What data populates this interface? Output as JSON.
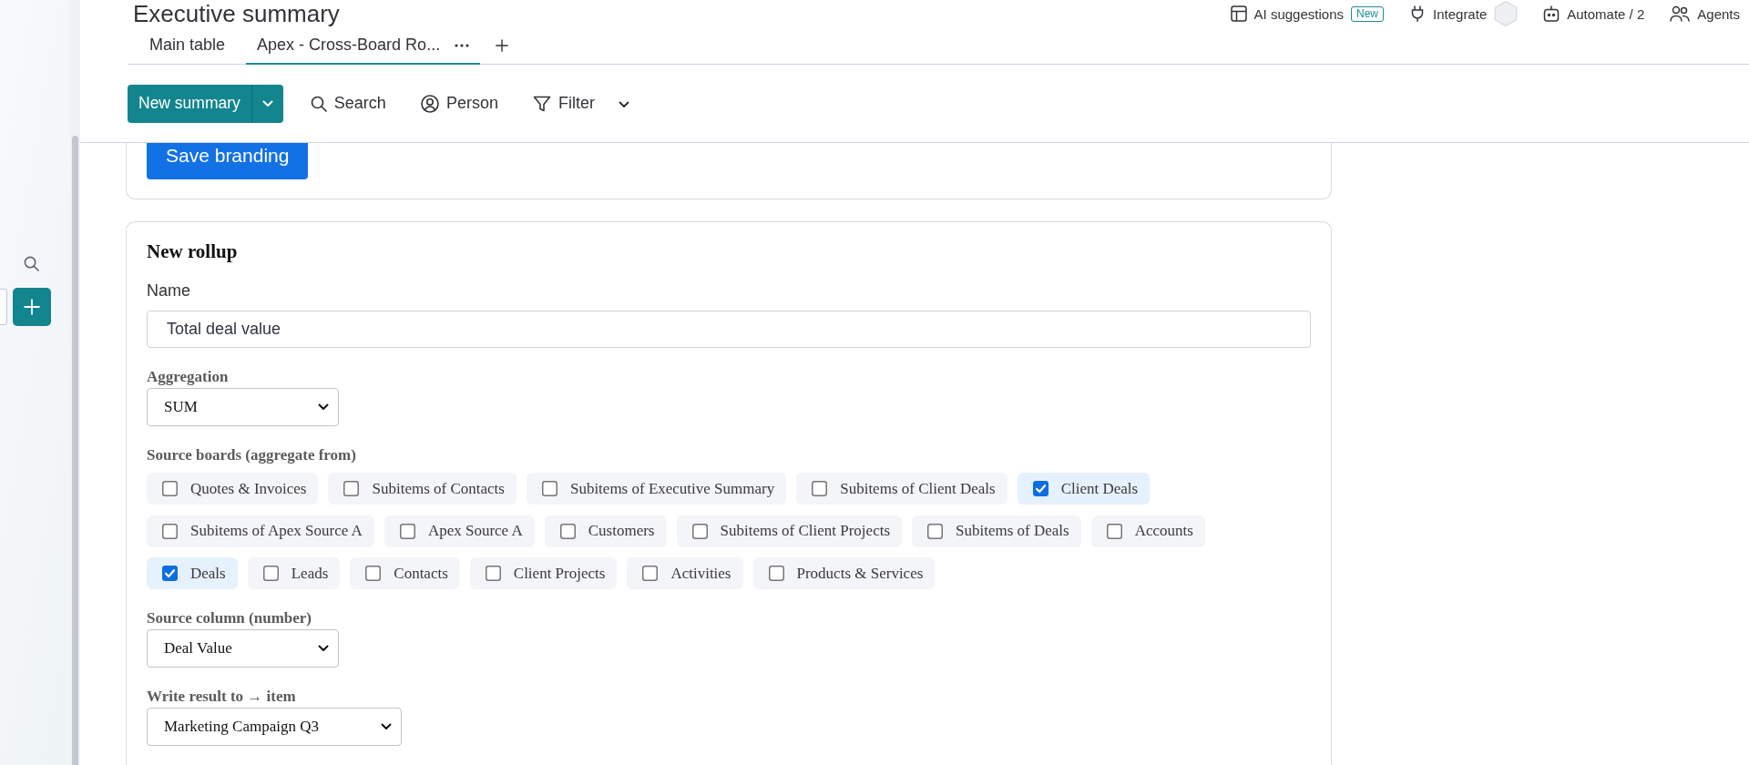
{
  "header": {
    "title": "Executive summary",
    "actions": [
      {
        "kind": "ai",
        "label": "AI suggestions",
        "badge": "New"
      },
      {
        "kind": "integrate",
        "label": "Integrate"
      },
      {
        "kind": "automate",
        "label": "Automate / 2"
      },
      {
        "kind": "agents",
        "label": "Agents"
      }
    ]
  },
  "tabs": [
    {
      "label": "Main table",
      "selected": false
    },
    {
      "label": "Apex - Cross-Board Ro...",
      "selected": true
    }
  ],
  "toolbar": {
    "primary_button": "New summary",
    "items": [
      {
        "kind": "search",
        "label": "Search"
      },
      {
        "kind": "person",
        "label": "Person"
      },
      {
        "kind": "filter",
        "label": "Filter"
      }
    ]
  },
  "branding": {
    "button": "Save branding"
  },
  "rollup": {
    "title": "New rollup",
    "name": {
      "label": "Name",
      "value": "Total deal value"
    },
    "aggregation": {
      "label": "Aggregation",
      "value": "SUM"
    },
    "source_boards": {
      "label": "Source boards (aggregate from)",
      "options": [
        {
          "label": "Quotes & Invoices",
          "checked": false
        },
        {
          "label": "Subitems of Contacts",
          "checked": false
        },
        {
          "label": "Subitems of Executive Summary",
          "checked": false
        },
        {
          "label": "Subitems of Client Deals",
          "checked": false
        },
        {
          "label": "Client Deals",
          "checked": true
        },
        {
          "label": "Subitems of Apex Source A",
          "checked": false
        },
        {
          "label": "Apex Source A",
          "checked": false
        },
        {
          "label": "Customers",
          "checked": false
        },
        {
          "label": "Subitems of Client Projects",
          "checked": false
        },
        {
          "label": "Subitems of Deals",
          "checked": false
        },
        {
          "label": "Accounts",
          "checked": false
        },
        {
          "label": "Deals",
          "checked": true
        },
        {
          "label": "Leads",
          "checked": false
        },
        {
          "label": "Contacts",
          "checked": false
        },
        {
          "label": "Client Projects",
          "checked": false
        },
        {
          "label": "Activities",
          "checked": false
        },
        {
          "label": "Products & Services",
          "checked": false
        }
      ]
    },
    "source_column": {
      "label": "Source column (number)",
      "value": "Deal Value"
    },
    "write_to": {
      "label": "Write result to → item",
      "value": "Marketing Campaign Q3"
    }
  }
}
